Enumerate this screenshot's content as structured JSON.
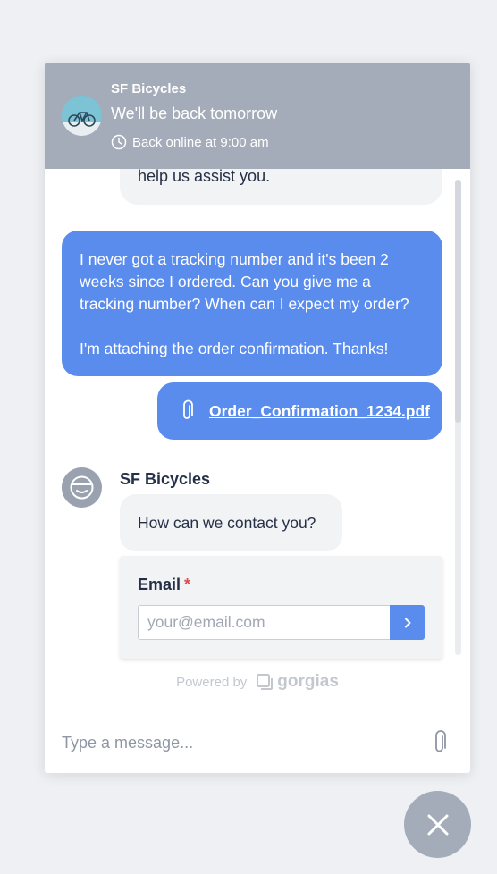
{
  "header": {
    "team_name": "SF Bicycles",
    "status": "We'll be back tomorrow",
    "hours": "Back online at 9:00 am"
  },
  "messages": {
    "partial_agent_text": "help us assist you.",
    "user_message": {
      "paragraph_1": "I never got a tracking number and it's been 2 weeks since I ordered. Can you give me a tracking number? When can I expect my order?",
      "paragraph_2": "I'm attaching the order confirmation. Thanks!"
    },
    "attachment": {
      "filename": "Order_Confirmation_1234.pdf"
    },
    "agent": {
      "name": "SF Bicycles",
      "question": "How can we contact you?"
    }
  },
  "contact_form": {
    "label": "Email",
    "required_marker": "*",
    "placeholder": "your@email.com"
  },
  "footer": {
    "powered_by": "Powered by",
    "brand": "gorgias"
  },
  "composer": {
    "placeholder": "Type a message..."
  },
  "colors": {
    "header_bg": "#a4acb9",
    "user_bubble": "#5a8cee",
    "agent_bubble": "#f2f3f5",
    "required": "#e5484d"
  },
  "icons": {
    "clock": "clock-icon",
    "paperclip": "paperclip-icon",
    "chevron": "chevron-right-icon",
    "close": "close-icon"
  }
}
